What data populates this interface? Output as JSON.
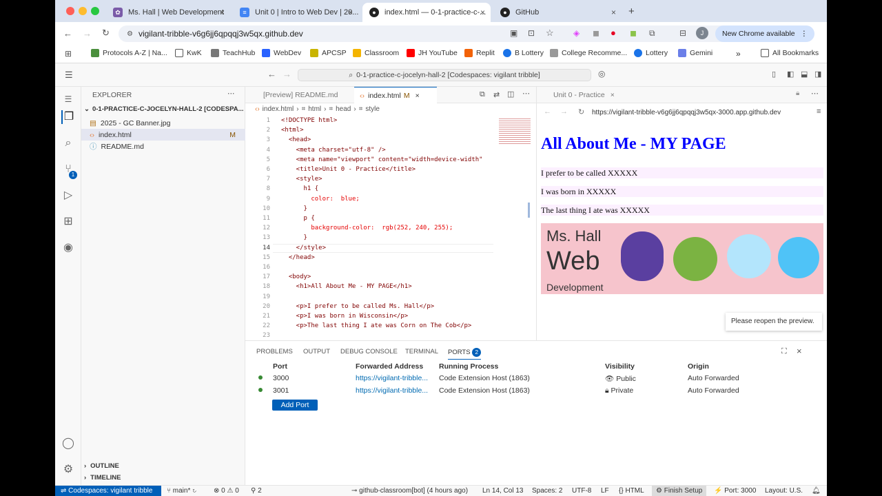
{
  "browser": {
    "tabs": [
      {
        "title": "Ms. Hall | Web Development",
        "color": "#7a5ba8"
      },
      {
        "title": "Unit 0 | Intro to Web Dev | 20...",
        "color": "#4285f4"
      },
      {
        "title": "index.html — 0-1-practice-c-...",
        "color": "#222222"
      },
      {
        "title": "GitHub",
        "color": "#222222"
      }
    ],
    "url": "vigilant-tribble-v6g6jj6qpqqj3w5qx.github.dev",
    "new_chrome": "New Chrome available",
    "profile_initial": "J",
    "bookmarks": [
      {
        "label": "Protocols A-Z | Na...",
        "color": "#4a8f3c"
      },
      {
        "label": "KwK",
        "color": "#555555"
      },
      {
        "label": "TeachHub",
        "color": "#777777"
      },
      {
        "label": "WebDev",
        "color": "#2962ff"
      },
      {
        "label": "APCSP",
        "color": "#c9b400"
      },
      {
        "label": "Classroom",
        "color": "#f4b400"
      },
      {
        "label": "JH YouTube",
        "color": "#ff0000"
      },
      {
        "label": "Replit",
        "color": "#f26207"
      },
      {
        "label": "B Lottery",
        "color": "#1a73e8"
      },
      {
        "label": "College Recomme...",
        "color": "#999999"
      },
      {
        "label": "Lottery",
        "color": "#1a73e8"
      },
      {
        "label": "Gemini",
        "color": "#6b7fe8"
      }
    ],
    "all_bookmarks": "All Bookmarks"
  },
  "vscode": {
    "command_center": "0-1-practice-c-jocelyn-hall-2 [Codespaces: vigilant tribble]",
    "explorer_title": "EXPLORER",
    "folder": "0-1-PRACTICE-C-JOCELYN-HALL-2 [CODESPA...",
    "files": [
      {
        "name": "2025 - GC Banner.jpg",
        "badge": ""
      },
      {
        "name": "index.html",
        "badge": "M"
      },
      {
        "name": "README.md",
        "badge": ""
      }
    ],
    "outline": "OUTLINE",
    "timeline": "TIMELINE",
    "scm_badge": "1",
    "editor_tabs": [
      {
        "label": "[Preview] README.md"
      },
      {
        "label": "index.html",
        "badge": "M"
      }
    ],
    "breadcrumb": [
      "index.html",
      "html",
      "head",
      "style"
    ],
    "code_lines": [
      "<!DOCTYPE html>",
      "<html>",
      "  <head>",
      "    <meta charset=\"utf-8\" />",
      "    <meta name=\"viewport\" content=\"width=device-width\"",
      "    <title>Unit 0 - Practice</title>",
      "    <style>",
      "      h1 {",
      "        color:  blue;",
      "      }",
      "      p {",
      "        background-color:  rgb(252, 240, 255);",
      "      }",
      "    </style>",
      "  </head>",
      "",
      "  <body>",
      "    <h1>All About Me - MY PAGE</h1>",
      "",
      "    <p>I prefer to be called Ms. Hall</p>",
      "    <p>I was born in Wisconsin</p>",
      "    <p>The last thing I ate was Corn on The Cob</p>",
      ""
    ],
    "preview": {
      "tab": "Unit 0 - Practice",
      "url": "https://vigilant-tribble-v6g6jj6qpqqj3w5qx-3000.app.github.dev",
      "h1": "All About Me - MY PAGE",
      "paragraphs": [
        "I prefer to be called XXXXX",
        "I was born in XXXXX",
        "The last thing I ate was XXXXX"
      ],
      "banner_line1": "Ms. Hall",
      "banner_line2": "Web",
      "banner_line3": "Development",
      "toast": "Please reopen the preview."
    },
    "panel": {
      "tabs": [
        "PROBLEMS",
        "OUTPUT",
        "DEBUG CONSOLE",
        "TERMINAL",
        "PORTS"
      ],
      "ports_badge": "2",
      "headers": [
        "Port",
        "Forwarded Address",
        "Running Process",
        "Visibility",
        "Origin"
      ],
      "rows": [
        {
          "port": "3000",
          "address": "https://vigilant-tribble...",
          "process": "Code Extension Host (1863)",
          "visibility": "Public",
          "origin": "Auto Forwarded"
        },
        {
          "port": "3001",
          "address": "https://vigilant-tribble...",
          "process": "Code Extension Host (1863)",
          "visibility": "Private",
          "origin": "Auto Forwarded"
        }
      ],
      "add_port": "Add Port"
    },
    "status": {
      "remote": "Codespaces: vigilant tribble",
      "branch": "main*",
      "errors": "0",
      "warnings": "0",
      "ports": "2",
      "author": "github-classroom[bot] (4 hours ago)",
      "position": "Ln 14, Col 13",
      "spaces": "Spaces: 2",
      "encoding": "UTF-8",
      "eol": "LF",
      "lang": "HTML",
      "finish": "Finish Setup",
      "port": "Port: 3000",
      "layout": "Layout: U.S."
    }
  }
}
